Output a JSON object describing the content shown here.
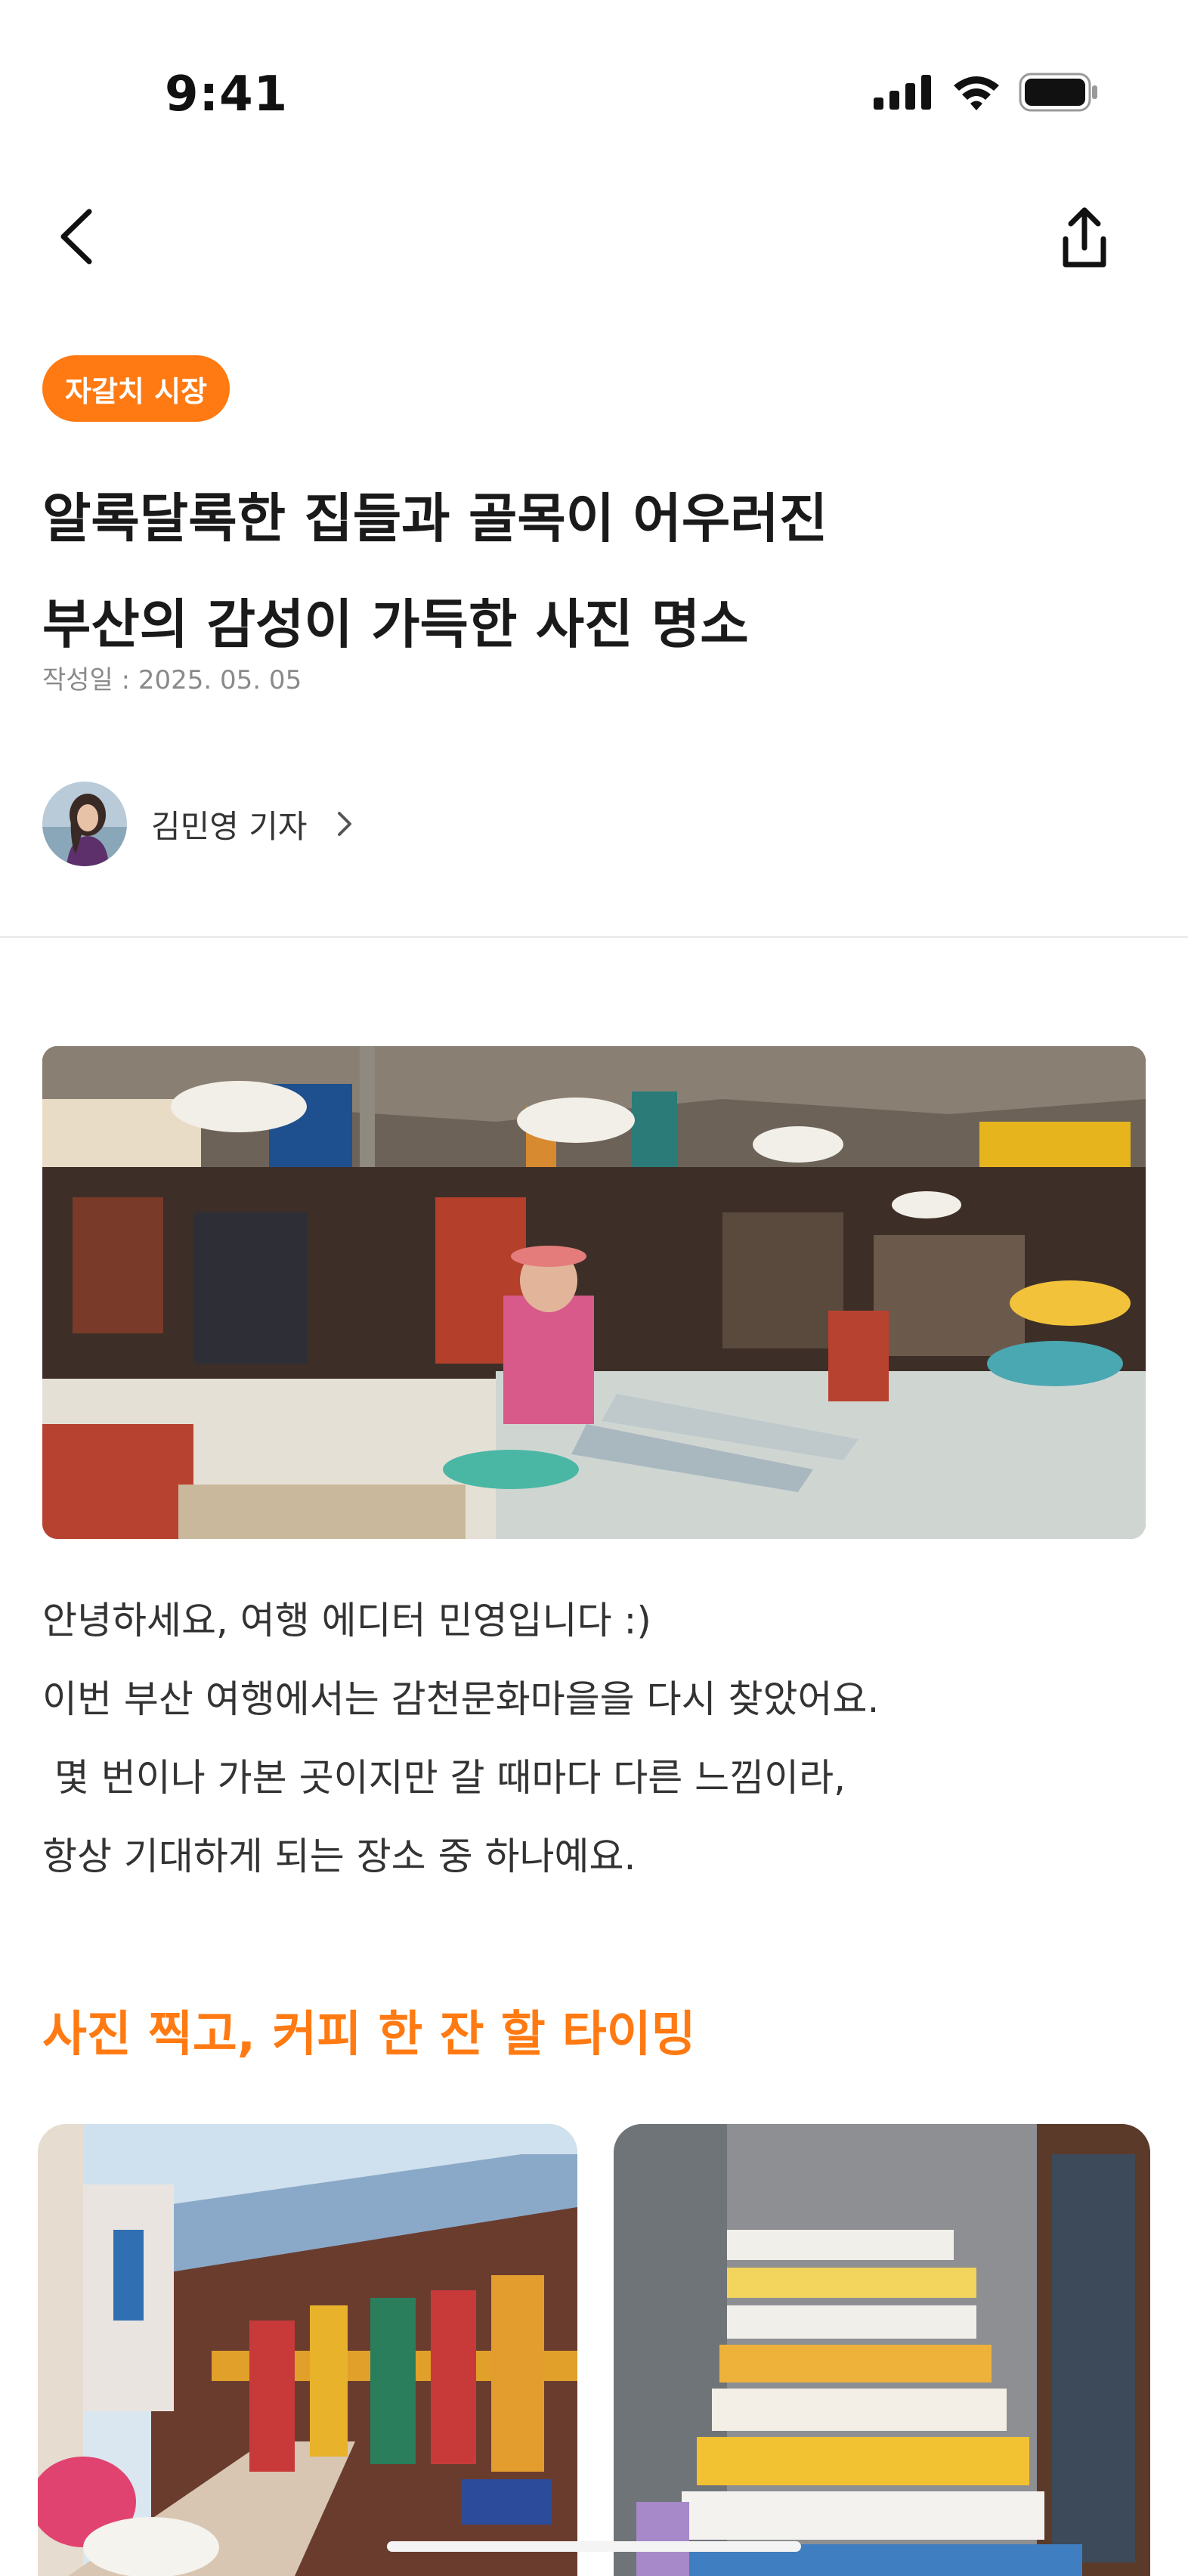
{
  "status_bar": {
    "time": "9:41"
  },
  "nav": {
    "back_icon": "chevron-left-icon",
    "share_icon": "share-icon"
  },
  "article": {
    "category": "자갈치 시장",
    "title_lines": [
      "알록달록한 집들과 골목이 어우러진",
      "부산의 감성이 가득한 사진 명소"
    ],
    "date": "작성일 : 2025. 05. 05",
    "author": "김민영 기자",
    "intro_lines": [
      "안녕하세요, 여행 에디터 민영입니다 :)",
      "이번 부산 여행에서는 감천문화마을을 다시 찾았어요.",
      " 몇 번이나 가본 곳이지만 갈 때마다 다른 느낌이라,",
      "항상 기대하게 되는 장소 중 하나예요."
    ],
    "section_title": "사진 찍고, 커피 한 잔 할 타이밍"
  },
  "colors": {
    "accent": "#ff7a12"
  }
}
